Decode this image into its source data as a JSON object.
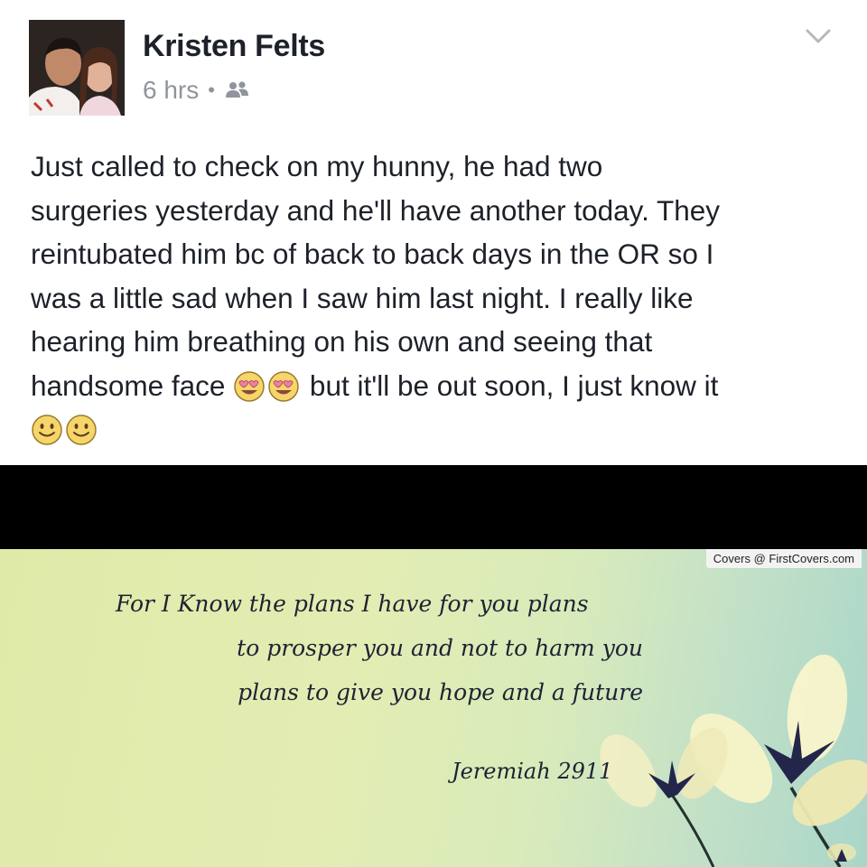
{
  "post": {
    "author_name": "Kristen Felts",
    "timestamp": "6 hrs",
    "separator": "•",
    "audience_icon": "friends-icon",
    "menu_icon": "chevron-down-icon",
    "text_lines": [
      "Just called to check on my hunny, he had two",
      "surgeries yesterday and he'll have another today. They",
      "reintubated him bc of back to back days in the OR so I",
      "was a little sad when I saw him last night. I really like",
      "hearing him breathing on his own and seeing that"
    ],
    "text_line6_before": "handsome face",
    "text_line6_after": " but it'll be out soon, I just know it",
    "emojis_line6": [
      "heart-eyes-emoji",
      "heart-eyes-emoji"
    ],
    "emojis_line7": [
      "smiley-emoji",
      "smiley-emoji"
    ]
  },
  "cover": {
    "watermark": "Covers @ FirstCovers.com",
    "verse_lines": [
      "For I Know the plans I have for you plans",
      "to prosper you and not to harm you",
      "plans to give you hope and a future"
    ],
    "reference": "Jeremiah 2911"
  },
  "colors": {
    "text_primary": "#1d2129",
    "text_secondary": "#90949c",
    "band": "#000000",
    "cover_left": "#dfeaa8",
    "cover_right": "#a9d6c9"
  }
}
